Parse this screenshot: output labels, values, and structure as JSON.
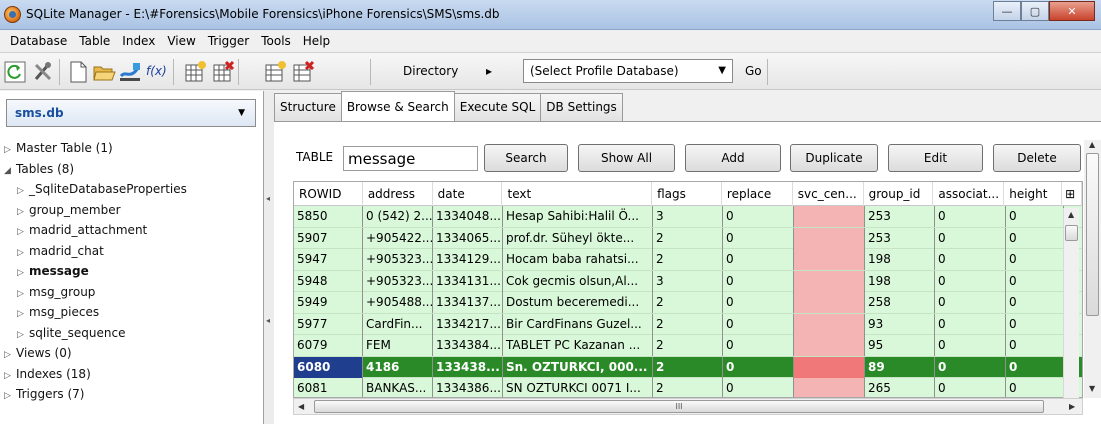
{
  "window": {
    "title": "SQLite Manager - E:\\#Forensics\\Mobile Forensics\\iPhone Forensics\\SMS\\sms.db",
    "minimize": "—",
    "maximize": "▢",
    "close": "✕"
  },
  "menu": [
    "Database",
    "Table",
    "Index",
    "View",
    "Trigger",
    "Tools",
    "Help"
  ],
  "toolbar": {
    "fx_label": "f(x)",
    "directory_label": "Directory",
    "directory_arrow": "▸",
    "profile_select": "(Select Profile Database)",
    "go_label": "Go"
  },
  "sidebar": {
    "db_name": "sms.db",
    "items": [
      {
        "label": "Master Table (1)",
        "tw": "▷"
      },
      {
        "label": "Tables (8)",
        "tw": "◢"
      },
      {
        "label": "_SqliteDatabaseProperties",
        "tw": "▷"
      },
      {
        "label": "group_member",
        "tw": "▷"
      },
      {
        "label": "madrid_attachment",
        "tw": "▷"
      },
      {
        "label": "madrid_chat",
        "tw": "▷"
      },
      {
        "label": "message",
        "tw": "▷"
      },
      {
        "label": "msg_group",
        "tw": "▷"
      },
      {
        "label": "msg_pieces",
        "tw": "▷"
      },
      {
        "label": "sqlite_sequence",
        "tw": "▷"
      },
      {
        "label": "Views (0)",
        "tw": "▷"
      },
      {
        "label": "Indexes (18)",
        "tw": "▷"
      },
      {
        "label": "Triggers (7)",
        "tw": "▷"
      }
    ]
  },
  "tabs": [
    "Structure",
    "Browse & Search",
    "Execute SQL",
    "DB Settings"
  ],
  "browse": {
    "table_label": "TABLE",
    "table_value": "message",
    "buttons": {
      "search": "Search",
      "show_all": "Show All",
      "add": "Add",
      "duplicate": "Duplicate",
      "edit": "Edit",
      "delete": "Delete"
    }
  },
  "grid": {
    "columns": [
      "ROWID",
      "address",
      "date",
      "text",
      "flags",
      "replace",
      "svc_cen...",
      "group_id",
      "associat...",
      "height"
    ],
    "rows": [
      [
        "5850",
        "0 (542) 2...",
        "1334048...",
        "Hesap Sahibi:Halil Ö...",
        "3",
        "0",
        "",
        "253",
        "0",
        "0"
      ],
      [
        "5907",
        "+905422...",
        "1334065...",
        "prof.dr. Süheyl ökte...",
        "2",
        "0",
        "",
        "253",
        "0",
        "0"
      ],
      [
        "5947",
        "+905323...",
        "1334129...",
        "Hocam baba rahatsi...",
        "2",
        "0",
        "",
        "198",
        "0",
        "0"
      ],
      [
        "5948",
        "+905323...",
        "1334131...",
        "Cok gecmis olsun,Al...",
        "3",
        "0",
        "",
        "198",
        "0",
        "0"
      ],
      [
        "5949",
        "+905488...",
        "1334137...",
        "Dostum beceremedi...",
        "2",
        "0",
        "",
        "258",
        "0",
        "0"
      ],
      [
        "5977",
        "CardFin...",
        "1334217...",
        "Bir CardFinans Guzel...",
        "2",
        "0",
        "",
        "93",
        "0",
        "0"
      ],
      [
        "6079",
        "FEM",
        "1334384...",
        "TABLET PC Kazanan ...",
        "2",
        "0",
        "",
        "95",
        "0",
        "0"
      ],
      [
        "6080",
        "4186",
        "133438...",
        "Sn. OZTURKCI, 000...",
        "2",
        "0",
        "",
        "89",
        "0",
        "0"
      ],
      [
        "6081",
        "BANKAS...",
        "1334386...",
        "SN OZTURKCI 0071 I...",
        "2",
        "0",
        "",
        "265",
        "0",
        "0"
      ]
    ],
    "selected_row": 7,
    "scroll_mark": "III"
  },
  "colors": {
    "row_bg": "#d9f7d9",
    "selected_bg": "#2a8a28",
    "pink_cell": "#f4b4b4"
  }
}
